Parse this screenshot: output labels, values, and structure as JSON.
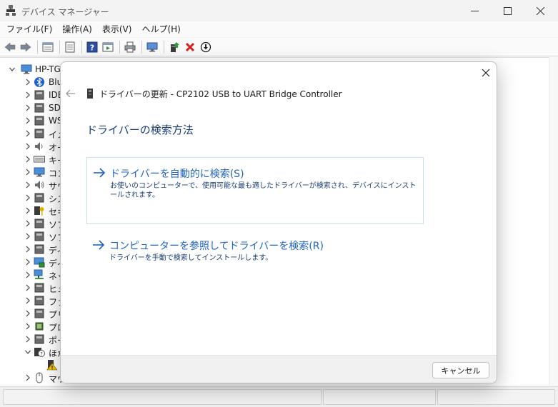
{
  "window": {
    "title": "デバイス マネージャー"
  },
  "menu": [
    "ファイル(F)",
    "操作(A)",
    "表示(V)",
    "ヘルプ(H)"
  ],
  "toolbar_icons": [
    "back-icon",
    "forward-icon",
    "properties-icon",
    "update-driver-icon",
    "help-icon",
    "view-icon",
    "print-icon",
    "monitor-icon",
    "add-driver-icon",
    "uninstall-icon",
    "download-icon"
  ],
  "tree": {
    "root": "HP-TG",
    "items": [
      {
        "label": "Blu",
        "icon": "bluetooth-icon"
      },
      {
        "label": "IDE",
        "icon": "ide-controller-icon"
      },
      {
        "label": "SD",
        "icon": "sd-host-icon"
      },
      {
        "label": "WS",
        "icon": "wsd-printer-icon"
      },
      {
        "label": "イメ",
        "icon": "imaging-device-icon"
      },
      {
        "label": "オー",
        "icon": "audio-icon"
      },
      {
        "label": "キー",
        "icon": "keyboard-icon"
      },
      {
        "label": "コン",
        "icon": "computer-icon"
      },
      {
        "label": "サウ",
        "icon": "sound-icon"
      },
      {
        "label": "シス",
        "icon": "system-device-icon"
      },
      {
        "label": "セキ",
        "icon": "security-device-icon"
      },
      {
        "label": "ソフ",
        "icon": "software-component-icon"
      },
      {
        "label": "ソフ",
        "icon": "software-device-icon"
      },
      {
        "label": "ディ",
        "icon": "disk-drive-icon"
      },
      {
        "label": "ディ",
        "icon": "display-adapter-icon"
      },
      {
        "label": "ネッ",
        "icon": "network-adapter-icon"
      },
      {
        "label": "ヒュ",
        "icon": "hid-icon"
      },
      {
        "label": "ファ",
        "icon": "firmware-icon"
      },
      {
        "label": "プリ",
        "icon": "print-queue-icon"
      },
      {
        "label": "プロ",
        "icon": "processor-icon"
      },
      {
        "label": "ポー",
        "icon": "ports-icon"
      },
      {
        "label": "ほか",
        "icon": "other-devices-icon"
      },
      {
        "label": "",
        "icon": "unknown-device-warning-icon"
      },
      {
        "label": "マウ",
        "icon": "mouse-icon"
      }
    ]
  },
  "dialog": {
    "header_title": "ドライバーの更新 - CP2102 USB to UART Bridge Controller",
    "heading": "ドライバーの検索方法",
    "option_auto": {
      "title": "ドライバーを自動的に検索(S)",
      "description": "お使いのコンピューターで、使用可能な最も適したドライバーが検索され、デバイスにインストールされます。"
    },
    "option_browse": {
      "title": "コンピューターを参照してドライバーを検索(R)",
      "description": "ドライバーを手動で検索してインストールします。"
    },
    "cancel_label": "キャンセル"
  },
  "colors": {
    "accent": "#1f63c4",
    "heading": "#1a3d78",
    "delete_red": "#d91e1e"
  }
}
